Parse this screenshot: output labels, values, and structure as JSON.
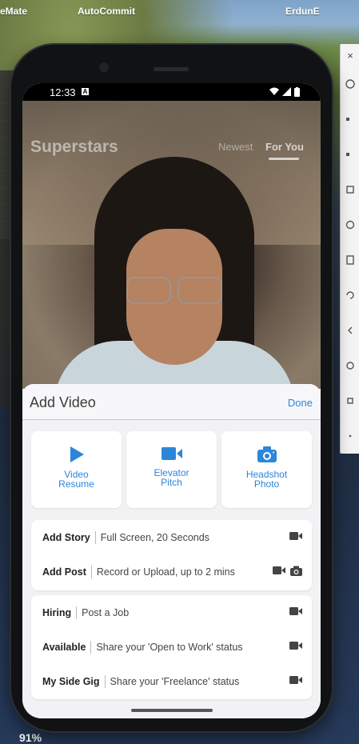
{
  "menubar": {
    "items": [
      "eMate",
      "AutoCommit",
      "ErdunE"
    ]
  },
  "desktop": {
    "battery": "91%"
  },
  "toolbar": {
    "close": "×"
  },
  "phone": {
    "status": {
      "time": "12:33",
      "notif_letter": "A"
    },
    "app": {
      "title": "Superstars",
      "tabs": [
        {
          "label": "Newest",
          "active": false
        },
        {
          "label": "For You",
          "active": true
        }
      ]
    },
    "sheet": {
      "title": "Add Video",
      "done_label": "Done",
      "tiles": [
        {
          "line1": "Video",
          "line2": "Resume",
          "icon": "play-icon"
        },
        {
          "line1": "Elevator",
          "line2": "Pitch",
          "icon": "video-camera-icon"
        },
        {
          "line1": "Headshot",
          "line2": "Photo",
          "icon": "camera-icon"
        }
      ],
      "group1": [
        {
          "label": "Add Story",
          "desc": "Full Screen, 20 Seconds",
          "icons": [
            "video-camera-icon"
          ]
        },
        {
          "label": "Add Post",
          "desc": "Record or Upload, up to 2 mins",
          "icons": [
            "video-camera-icon",
            "camera-icon"
          ]
        }
      ],
      "group2": [
        {
          "label": "Hiring",
          "desc": "Post a Job",
          "icons": [
            "video-camera-icon"
          ]
        },
        {
          "label": "Available",
          "desc": "Share your 'Open to Work' status",
          "icons": [
            "video-camera-icon"
          ]
        },
        {
          "label": "My Side Gig",
          "desc": "Share your 'Freelance' status",
          "icons": [
            "video-camera-icon"
          ]
        }
      ]
    }
  },
  "colors": {
    "accent": "#2b86d9",
    "sheet_bg": "#f2f2f4"
  }
}
